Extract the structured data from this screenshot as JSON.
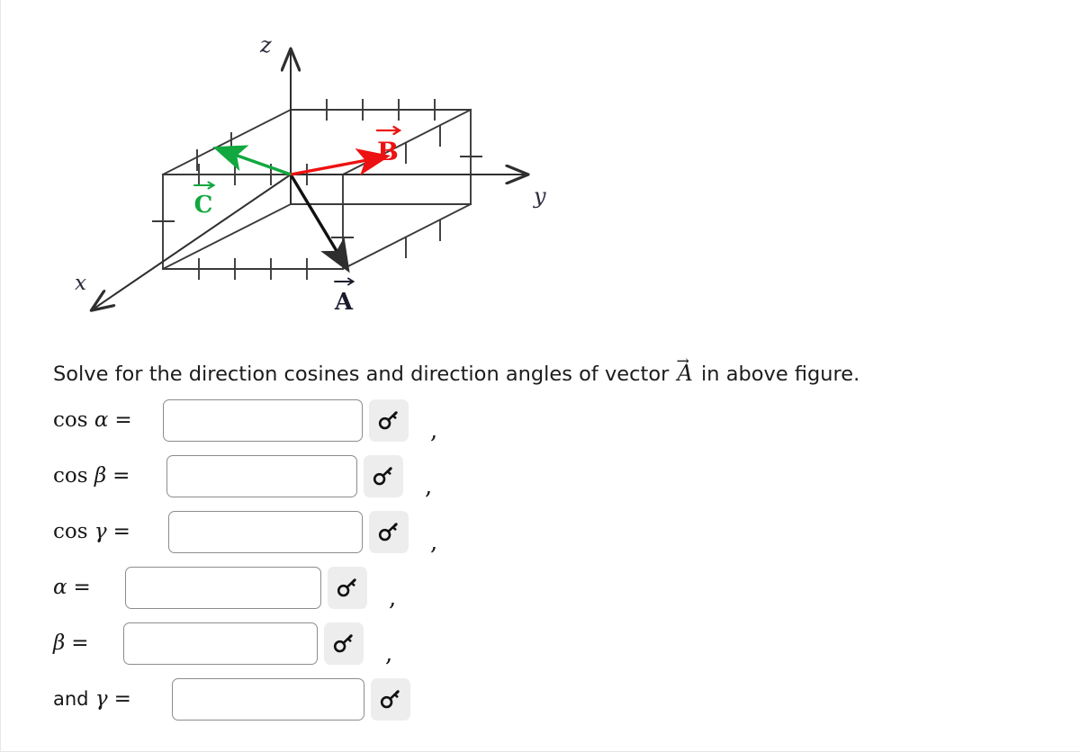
{
  "figure": {
    "axis_labels": {
      "x": "x",
      "y": "y",
      "z": "z"
    },
    "vectors": [
      {
        "name": "A",
        "label": "A",
        "color": "#111111",
        "overarrow": true
      },
      {
        "name": "B",
        "label": "B",
        "color": "#ee1111",
        "overarrow": true
      },
      {
        "name": "C",
        "label": "C",
        "color": "#11aa44",
        "overarrow": true
      }
    ],
    "description": "3D rectangular box with x, y, z axes and three vectors A, B, C drawn from the origin"
  },
  "question": {
    "text_before": "Solve for the direction cosines and direction angles of vector",
    "vector_symbol": "A",
    "vector_overarrow": "→",
    "text_after": "in above figure."
  },
  "rows": [
    {
      "id": "cos-alpha",
      "prefix": "cos",
      "symbol": "α",
      "equals": "=",
      "value": "",
      "placeholder": "",
      "key_icon": "key-icon",
      "separator": ","
    },
    {
      "id": "cos-beta",
      "prefix": "cos",
      "symbol": "β",
      "equals": "=",
      "value": "",
      "placeholder": "",
      "key_icon": "key-icon",
      "separator": ","
    },
    {
      "id": "cos-gamma",
      "prefix": "cos",
      "symbol": "γ",
      "equals": "=",
      "value": "",
      "placeholder": "",
      "key_icon": "key-icon",
      "separator": ","
    },
    {
      "id": "alpha",
      "prefix": "",
      "symbol": "α",
      "equals": "=",
      "value": "",
      "placeholder": "",
      "key_icon": "key-icon",
      "separator": ","
    },
    {
      "id": "beta",
      "prefix": "",
      "symbol": "β",
      "equals": "=",
      "value": "",
      "placeholder": "",
      "key_icon": "key-icon",
      "separator": ","
    },
    {
      "id": "gamma",
      "prefix": "and",
      "symbol": "γ",
      "equals": "=",
      "value": "",
      "placeholder": "",
      "key_icon": "key-icon",
      "separator": ""
    }
  ],
  "colors": {
    "vector_a": "#111111",
    "vector_b": "#ee1111",
    "vector_c": "#11aa44",
    "axis_label": "#2b2b3c",
    "box_line": "#3a3a3a",
    "input_border": "#8c8c8c",
    "key_button_bg": "#ededed"
  }
}
